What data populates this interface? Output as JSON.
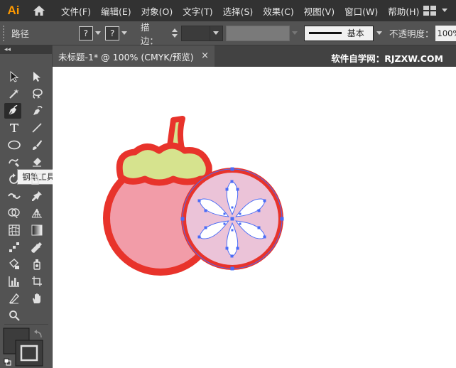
{
  "app": {
    "logo_text": "Ai"
  },
  "menu": {
    "items": [
      {
        "label": "文件(F)"
      },
      {
        "label": "编辑(E)"
      },
      {
        "label": "对象(O)"
      },
      {
        "label": "文字(T)"
      },
      {
        "label": "选择(S)"
      },
      {
        "label": "效果(C)"
      },
      {
        "label": "视图(V)"
      },
      {
        "label": "窗口(W)"
      },
      {
        "label": "帮助(H)"
      }
    ]
  },
  "control_bar": {
    "selection_label": "路径",
    "fill_placeholder": "?",
    "stroke_placeholder": "?",
    "stroke_label": "描边：",
    "brush_label": "基本",
    "opacity_label": "不透明度：",
    "opacity_value": "100%"
  },
  "document": {
    "tab_title": "未标题-1* @ 100% (CMYK/预览)",
    "close_glyph": "×",
    "watermark": "软件自学网：RJZXW.COM"
  },
  "toolbox": {
    "collapse_glyph": "◂◂",
    "tooltip": "钢笔工具 (P)",
    "active_tool": "pen-tool"
  },
  "colors": {
    "menubar_bg": "#323232",
    "panel_bg": "#535353",
    "logo": "#ff9a00",
    "fruit_outline": "#e8332b",
    "fruit_body": "#f29ca8",
    "fruit_leaf": "#d6e38e",
    "slice_inner": "#ebc3d8",
    "selection": "#4a6cf7"
  }
}
